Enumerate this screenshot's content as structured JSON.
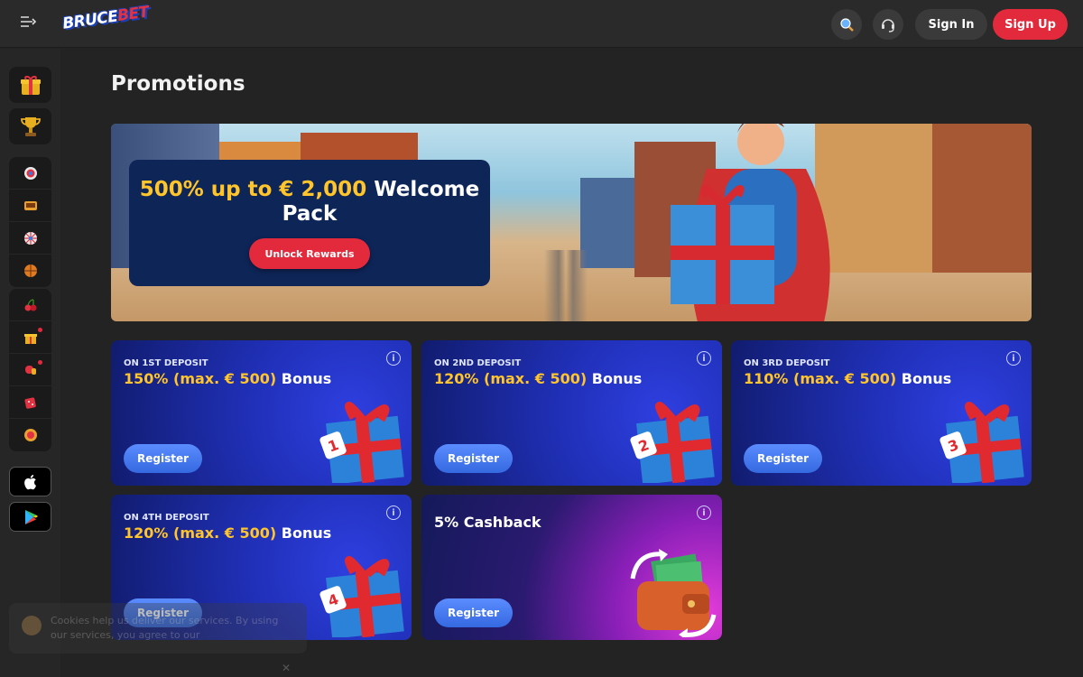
{
  "header": {
    "logo_text_1": "BRUCE",
    "logo_text_2": "BET",
    "sign_in_label": "Sign In",
    "sign_up_label": "Sign Up"
  },
  "sidebar": {
    "items": [
      {
        "icon": "gift-icon"
      },
      {
        "icon": "trophy-icon"
      },
      {
        "icon": "target-icon"
      },
      {
        "icon": "slots-icon"
      },
      {
        "icon": "wheel-icon"
      },
      {
        "icon": "basketball-icon"
      },
      {
        "icon": "cherries-icon"
      },
      {
        "icon": "gift-box-icon",
        "badge": true
      },
      {
        "icon": "boxing-glove-icon",
        "badge": true
      },
      {
        "icon": "dice-icon"
      },
      {
        "icon": "chip-icon"
      }
    ],
    "apps": [
      "apple-icon",
      "google-play-icon"
    ]
  },
  "main": {
    "page_title": "Promotions",
    "hero": {
      "headline_highlight": "500% up to € 2,000",
      "headline_rest": "Welcome Pack",
      "cta_label": "Unlock Rewards"
    },
    "promos": [
      {
        "subtitle": "ON 1ST DEPOSIT",
        "highlight": "150% (max. € 500)",
        "rest": "Bonus",
        "button": "Register",
        "number": "1"
      },
      {
        "subtitle": "ON 2ND DEPOSIT",
        "highlight": "120% (max. € 500)",
        "rest": "Bonus",
        "button": "Register",
        "number": "2"
      },
      {
        "subtitle": "ON 3RD DEPOSIT",
        "highlight": "110% (max. € 500)",
        "rest": "Bonus",
        "button": "Register",
        "number": "3"
      },
      {
        "subtitle": "ON 4TH DEPOSIT",
        "highlight": "120% (max. € 500)",
        "rest": "Bonus",
        "button": "Register",
        "number": "4"
      },
      {
        "title": "5% Cashback",
        "button": "Register"
      }
    ]
  },
  "cookie_banner": {
    "text": "Cookies help us deliver our services. By using our services, you agree to our",
    "close": "✕"
  },
  "colors": {
    "accent_red": "#e32a3c",
    "accent_yellow": "#ffc52a",
    "promo_blue": "#2030b8",
    "register_blue": "#3569e0"
  }
}
